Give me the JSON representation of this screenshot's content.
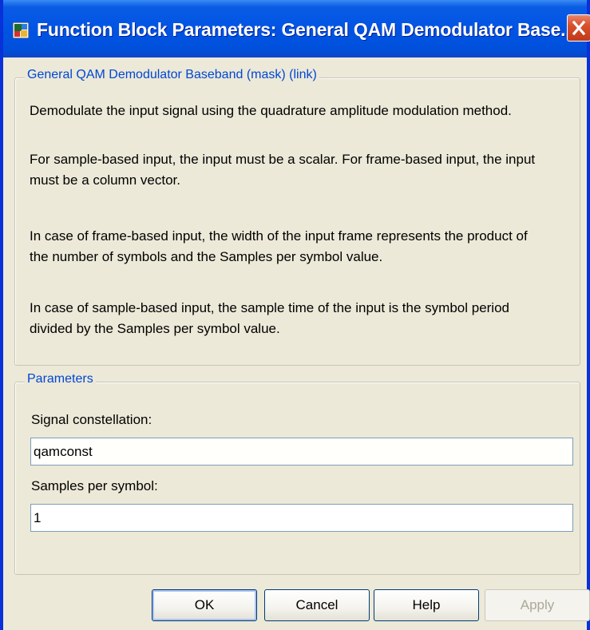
{
  "window": {
    "title": "Function Block Parameters: General QAM Demodulator Base...",
    "close_symbol": "X"
  },
  "icons": {
    "app": "simulink-block-icon",
    "close": "close-icon"
  },
  "description_group": {
    "legend": "General QAM Demodulator Baseband (mask) (link)",
    "paragraphs": [
      [
        "Demodulate the input signal using the quadrature amplitude modulation method."
      ],
      [
        "For sample-based input, the input must be a scalar. For frame-based input, the input",
        "must be a column vector."
      ],
      [
        "In case of frame-based input, the width of the input frame represents the product of",
        "the number of symbols and the Samples per symbol value."
      ],
      [
        "In case of sample-based input, the sample time of the input is the symbol period",
        "divided by the Samples per symbol value."
      ]
    ]
  },
  "parameters_group": {
    "legend": "Parameters",
    "signal_constellation": {
      "label": "Signal constellation:",
      "value": "qamconst"
    },
    "samples_per_symbol": {
      "label": "Samples per symbol:",
      "value": "1"
    }
  },
  "buttons": {
    "ok": "OK",
    "cancel": "Cancel",
    "help": "Help",
    "apply": "Apply"
  },
  "colors": {
    "title_bar": "#0054e3",
    "group_legend": "#0046d5",
    "dialog_background": "#ece9d8",
    "close_button": "#d8502c"
  }
}
